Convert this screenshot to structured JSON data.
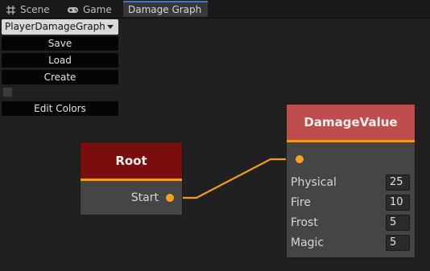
{
  "tabs": [
    {
      "label": "Scene",
      "icon": "grid-icon"
    },
    {
      "label": "Game",
      "icon": "gamepad-icon"
    },
    {
      "label": "Damage Graph",
      "icon": ""
    }
  ],
  "panel": {
    "graph_select": "PlayerDamageGraph",
    "save_label": "Save",
    "load_label": "Load",
    "create_label": "Create",
    "checkbox_checked": false,
    "edit_colors_label": "Edit Colors"
  },
  "nodes": {
    "root": {
      "title": "Root",
      "output_port": "Start",
      "header_color": "#7a0e0e"
    },
    "damage_value": {
      "title": "DamageValue",
      "header_color": "#bf4d4d",
      "fields": [
        {
          "label": "Physical",
          "value": "25"
        },
        {
          "label": "Fire",
          "value": "10"
        },
        {
          "label": "Frost",
          "value": "5"
        },
        {
          "label": "Magic",
          "value": "5"
        }
      ]
    }
  },
  "colors": {
    "port": "#f5a11c",
    "wire": "#f29a1c",
    "active_tab_accent": "#3a78c8"
  }
}
